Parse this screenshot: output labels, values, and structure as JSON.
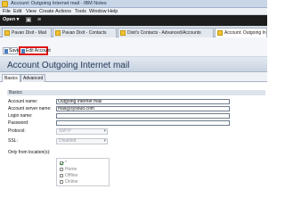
{
  "window": {
    "title": "Account: Outgoing Internet mail - IBM Notes"
  },
  "menu": [
    "File",
    "Edit",
    "View",
    "Create",
    "Actions",
    "Tools",
    "Window",
    "Help"
  ],
  "toolbar": {
    "open_label": "Open ▾"
  },
  "tabs": [
    {
      "label": "Pavan Dixit - Mail",
      "active": false
    },
    {
      "label": "Pavan Dixit - Contacts",
      "active": false
    },
    {
      "label": "Dixit's Contacts - Advanced\\Accounts",
      "active": false
    },
    {
      "label": "Account: Outgoing In",
      "active": true
    }
  ],
  "actions": {
    "save_label": "Save",
    "edit_label": "Edit Account"
  },
  "document": {
    "title": "Account Outgoing Internet mail",
    "subtabs": [
      "Basics",
      "Advanced"
    ],
    "section": "Basics"
  },
  "form": {
    "account_name_label": "Account name:",
    "account_name_value": "Outgoing Internet mail",
    "server_label": "Account server name:",
    "server_value": "mail@sysbud.com",
    "login_label": "Login name:",
    "login_value": "",
    "password_label": "Password:",
    "password_value": "",
    "protocol_label": "Protocol:",
    "protocol_value": "SMTP",
    "ssl_label": "SSL:",
    "ssl_value": "Disabled",
    "locations_label": "Only from location(s):",
    "locations": [
      {
        "label": "*",
        "checked": true
      },
      {
        "label": "Home",
        "checked": false
      },
      {
        "label": "Offline",
        "checked": false
      },
      {
        "label": "Online",
        "checked": false
      }
    ]
  }
}
